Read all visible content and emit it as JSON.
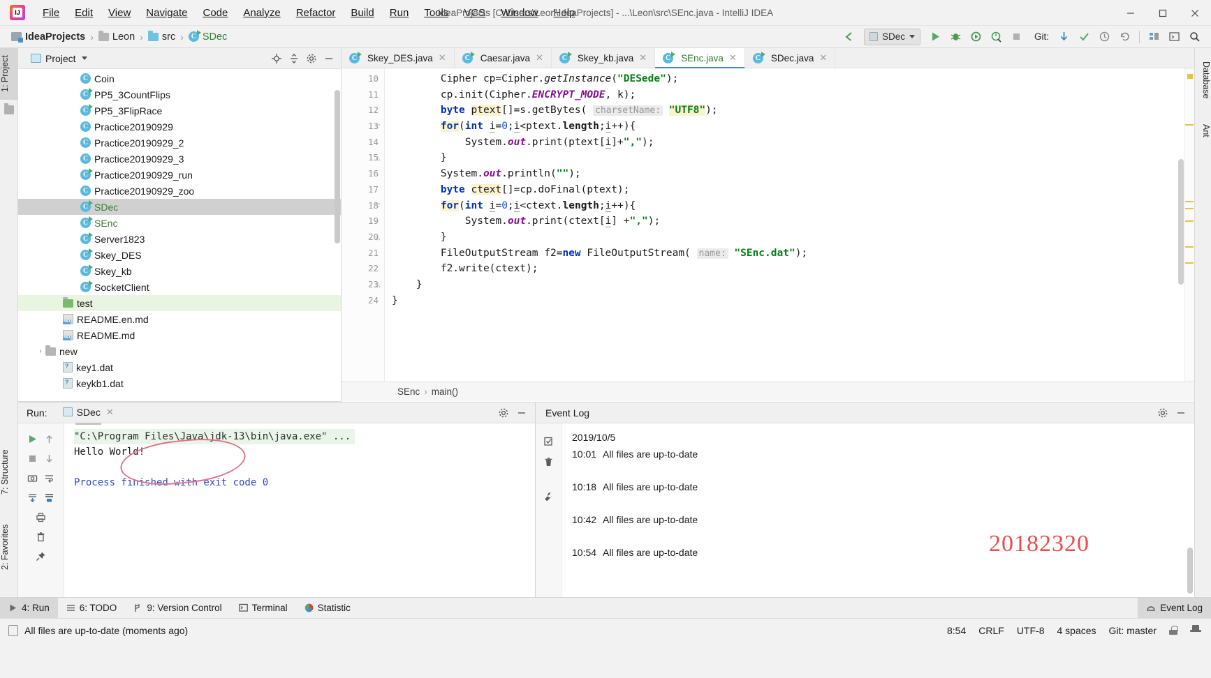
{
  "window": {
    "title": "IdeaProjects [C:\\Users\\Leon\\IdeaProjects] - ...\\Leon\\src\\SEnc.java - IntelliJ IDEA",
    "minimize": "─",
    "maximize": "☐",
    "close": "✕"
  },
  "menu": {
    "items": [
      {
        "label": "File"
      },
      {
        "label": "Edit"
      },
      {
        "label": "View"
      },
      {
        "label": "Navigate"
      },
      {
        "label": "Code"
      },
      {
        "label": "Analyze"
      },
      {
        "label": "Refactor"
      },
      {
        "label": "Build"
      },
      {
        "label": "Run"
      },
      {
        "label": "Tools"
      },
      {
        "label": "VCS"
      },
      {
        "label": "Window"
      },
      {
        "label": "Help"
      }
    ]
  },
  "breadcrumbs": {
    "items": [
      {
        "label": "IdeaProjects",
        "icon": "module-icon"
      },
      {
        "label": "Leon",
        "icon": "folder-icon"
      },
      {
        "label": "src",
        "icon": "source-folder-icon"
      },
      {
        "label": "SDec",
        "icon": "class-icon"
      }
    ],
    "separator": "›"
  },
  "toolbar": {
    "back_arrow": "↖",
    "run_config": "SDec",
    "run": "▶",
    "debug": "debug-icon",
    "run_coverage": "run-with-coverage-icon",
    "profile": "profiler-icon",
    "stop": "■",
    "git_label": "Git:",
    "git_update": "update-project-icon",
    "git_commit": "✓",
    "git_history": "history-icon",
    "git_rollback": "↶",
    "structure": "structure-icon",
    "terminal": "terminal-icon",
    "search": "search-everywhere-icon"
  },
  "left_strip": {
    "project_tab": "1: Project",
    "structure_tab": "7: Structure",
    "favorites_tab": "2: Favorites"
  },
  "right_strip": {
    "database_tab": "Database",
    "ant_tab": "Ant"
  },
  "project_panel": {
    "title": "Project",
    "dropdown_caret": "▾",
    "locate_icon": "locate-file-icon",
    "collapse_icon": "collapse-all-icon",
    "settings_icon": "gear-icon",
    "hide_icon": "─",
    "tree": [
      {
        "label": "Coin",
        "type": "class",
        "runnable": false,
        "indent": 3,
        "selected": false
      },
      {
        "label": "PP5_3CountFlips",
        "type": "class",
        "runnable": true,
        "indent": 3,
        "selected": false
      },
      {
        "label": "PP5_3FlipRace",
        "type": "class",
        "runnable": true,
        "indent": 3,
        "selected": false
      },
      {
        "label": "Practice20190929",
        "type": "class",
        "runnable": false,
        "indent": 3,
        "selected": false
      },
      {
        "label": "Practice20190929_2",
        "type": "class",
        "runnable": false,
        "indent": 3,
        "selected": false
      },
      {
        "label": "Practice20190929_3",
        "type": "class",
        "runnable": false,
        "indent": 3,
        "selected": false
      },
      {
        "label": "Practice20190929_run",
        "type": "class",
        "runnable": true,
        "indent": 3,
        "selected": false
      },
      {
        "label": "Practice20190929_zoo",
        "type": "class",
        "runnable": false,
        "indent": 3,
        "selected": false
      },
      {
        "label": "SDec",
        "type": "class",
        "runnable": true,
        "indent": 3,
        "selected": true,
        "green": true
      },
      {
        "label": "SEnc",
        "type": "class",
        "runnable": true,
        "indent": 3,
        "selected": false,
        "green": true
      },
      {
        "label": "Server1823",
        "type": "class",
        "runnable": true,
        "indent": 3,
        "selected": false
      },
      {
        "label": "Skey_DES",
        "type": "class",
        "runnable": true,
        "indent": 3,
        "selected": false
      },
      {
        "label": "Skey_kb",
        "type": "class",
        "runnable": true,
        "indent": 3,
        "selected": false
      },
      {
        "label": "SocketClient",
        "type": "class",
        "runnable": true,
        "indent": 3,
        "selected": false
      },
      {
        "label": "test",
        "type": "folder-green",
        "indent": 2,
        "selected": false,
        "highlight": true
      },
      {
        "label": "README.en.md",
        "type": "markdown",
        "indent": 2,
        "selected": false
      },
      {
        "label": "README.md",
        "type": "markdown",
        "indent": 2,
        "selected": false
      },
      {
        "label": "new",
        "type": "folder",
        "indent": 1,
        "selected": false,
        "twisty": "›"
      },
      {
        "label": "key1.dat",
        "type": "dat",
        "indent": 2,
        "selected": false
      },
      {
        "label": "keykb1.dat",
        "type": "dat",
        "indent": 2,
        "selected": false
      }
    ]
  },
  "editor": {
    "tabs": [
      {
        "label": "Skey_DES.java",
        "active": false,
        "green": false
      },
      {
        "label": "Caesar.java",
        "active": false,
        "green": false
      },
      {
        "label": "Skey_kb.java",
        "active": false,
        "green": false
      },
      {
        "label": "SEnc.java",
        "active": true,
        "green": true
      },
      {
        "label": "SDec.java",
        "active": false,
        "green": false
      }
    ],
    "tab_close": "✕",
    "first_line_number": 10,
    "lines": [
      {
        "n": 10,
        "fold": ""
      },
      {
        "n": 11,
        "fold": ""
      },
      {
        "n": 12,
        "fold": ""
      },
      {
        "n": 13,
        "fold": "▽"
      },
      {
        "n": 14,
        "fold": ""
      },
      {
        "n": 15,
        "fold": "△"
      },
      {
        "n": 16,
        "fold": ""
      },
      {
        "n": 17,
        "fold": ""
      },
      {
        "n": 18,
        "fold": "▽"
      },
      {
        "n": 19,
        "fold": ""
      },
      {
        "n": 20,
        "fold": "△"
      },
      {
        "n": 21,
        "fold": ""
      },
      {
        "n": 22,
        "fold": ""
      },
      {
        "n": 23,
        "fold": "△"
      },
      {
        "n": 24,
        "fold": ""
      }
    ],
    "code_text": [
      "        Cipher cp=Cipher.getInstance(\"DESede\");",
      "        cp.init(Cipher.ENCRYPT_MODE, k);",
      "        byte ptext[]=s.getBytes( charsetName: \"UTF8\");",
      "        for(int i=0;i<ptext.length;i++){",
      "            System.out.print(ptext[i]+\",\");",
      "        }",
      "        System.out.println(\"\");",
      "        byte ctext[]=cp.doFinal(ptext);",
      "        for(int i=0;i<ctext.length;i++){",
      "            System.out.print(ctext[i] +\",\");",
      "        }",
      "        FileOutputStream f2=new FileOutputStream( name: \"SEnc.dat\");",
      "        f2.write(ctext);",
      "    }",
      "}"
    ],
    "breadcrumb": {
      "class": "SEnc",
      "method": "main()",
      "separator": "›"
    }
  },
  "run_panel": {
    "label": "Run:",
    "tab": "SDec",
    "tab_close": "✕",
    "settings_icon": "gear-icon",
    "hide_icon": "─",
    "gutter_actions": [
      "rerun-icon",
      "up-arrow-icon",
      "stop-icon",
      "down-arrow-icon",
      "camera-icon",
      "soft-wrap-icon",
      "scroll-to-end-icon",
      "scroll-lock-icon",
      "print-icon",
      "clear-all-icon",
      "pin-icon"
    ],
    "console": [
      {
        "text": "\"C:\\Program Files\\Java\\jdk-13\\bin\\java.exe\" ...",
        "style": "cmd"
      },
      {
        "text": "Hello World!",
        "style": "out"
      },
      {
        "text": "",
        "style": "out"
      },
      {
        "text": "Process finished with exit code 0",
        "style": "fin"
      }
    ]
  },
  "event_log": {
    "title": "Event Log",
    "settings_icon": "gear-icon",
    "hide_icon": "─",
    "gutter_icons": [
      "mark-read-icon",
      "trash-icon",
      "settings-wrench-icon"
    ],
    "entries": [
      {
        "time": "",
        "text": "2019/10/5"
      },
      {
        "time": "10:01",
        "text": "All files are up-to-date"
      },
      {
        "time": "10:18",
        "text": "All files are up-to-date"
      },
      {
        "time": "10:42",
        "text": "All files are up-to-date"
      },
      {
        "time": "10:54",
        "text": "All files are up-to-date"
      }
    ],
    "stamp": "20182320",
    "stamp_color": "#ef4a4a"
  },
  "bottom_bar": {
    "items": [
      {
        "label": "4: Run",
        "num": "4",
        "icon": "run-icon",
        "selected": true
      },
      {
        "label": "6: TODO",
        "num": "6",
        "icon": "todo-icon",
        "selected": false
      },
      {
        "label": "9: Version Control",
        "num": "9",
        "icon": "branch-icon",
        "selected": false
      },
      {
        "label": "Terminal",
        "num": "",
        "icon": "terminal-icon",
        "selected": false
      },
      {
        "label": "Statistic",
        "num": "",
        "icon": "statistic-icon",
        "selected": false
      }
    ],
    "event_log_button": "Event Log"
  },
  "status_bar": {
    "message": "All files are up-to-date (moments ago)",
    "caret": "8:54",
    "line_separator": "CRLF",
    "encoding": "UTF-8",
    "indent": "4 spaces",
    "git_branch": "Git: master",
    "lock_icon": "unlocked-icon",
    "inspector_icon": "hector-icon"
  },
  "colors": {
    "accent_blue": "#4a86c7",
    "keyword": "#0033b3",
    "string": "#067d17",
    "static_field": "#871094",
    "annotation_red": "#ef4a4a",
    "selection": "#d0d0d0"
  }
}
